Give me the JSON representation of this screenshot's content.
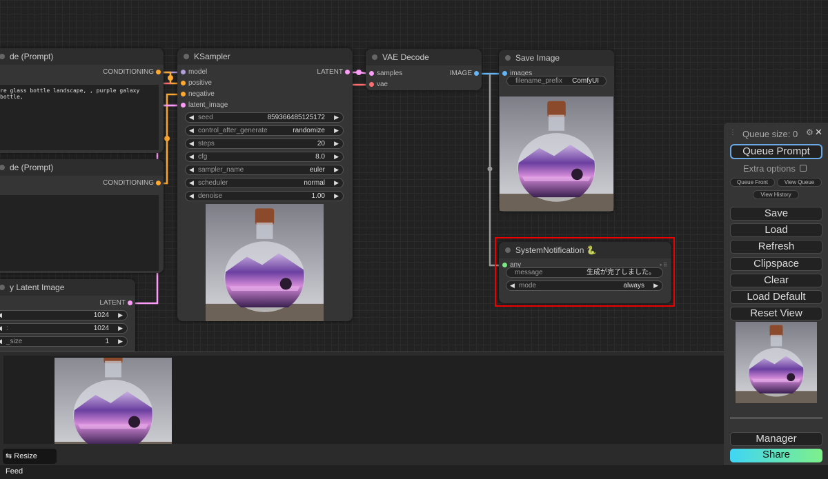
{
  "colors": {
    "conditioning": "#ffa931",
    "latent": "#ff9cf9",
    "model": "#b39ddb",
    "vae": "#ff6e6e",
    "image": "#64b5f6",
    "any": "#7ee787",
    "highlight": "#ee0000",
    "share_gradient": [
      "#3fd5f5",
      "#7ef08a"
    ]
  },
  "nodes": {
    "clip1": {
      "title": "de (Prompt)",
      "outputs": [
        "CONDITIONING"
      ],
      "text": "re glass bottle landscape, , purple galaxy bottle,"
    },
    "clip2": {
      "title": "de (Prompt)",
      "outputs": [
        "CONDITIONING"
      ],
      "text": ""
    },
    "latent": {
      "title": "y Latent Image",
      "outputs": [
        "LATENT"
      ],
      "widgets": [
        {
          "label": "",
          "value": "1024"
        },
        {
          "label": ":",
          "value": "1024"
        },
        {
          "label": "_size",
          "value": "1"
        }
      ]
    },
    "ksampler": {
      "title": "KSampler",
      "inputs": [
        "model",
        "positive",
        "negative",
        "latent_image"
      ],
      "outputs": [
        "LATENT"
      ],
      "widgets": [
        {
          "label": "seed",
          "value": "859366485125172"
        },
        {
          "label": "control_after_generate",
          "value": "randomize"
        },
        {
          "label": "steps",
          "value": "20"
        },
        {
          "label": "cfg",
          "value": "8.0"
        },
        {
          "label": "sampler_name",
          "value": "euler"
        },
        {
          "label": "scheduler",
          "value": "normal"
        },
        {
          "label": "denoise",
          "value": "1.00"
        }
      ]
    },
    "vae": {
      "title": "VAE Decode",
      "inputs": [
        "samples",
        "vae"
      ],
      "outputs": [
        "IMAGE"
      ]
    },
    "save": {
      "title": "Save Image",
      "inputs": [
        "images"
      ],
      "widgets": [
        {
          "label": "filename_prefix",
          "value": "ComfyUI",
          "text": true
        }
      ]
    },
    "notify": {
      "title": "SystemNotification 🐍",
      "inputs": [
        "any"
      ],
      "widgets": [
        {
          "label": "message",
          "value": "生成が完了しました。",
          "text": true
        },
        {
          "label": "mode",
          "value": "always"
        }
      ]
    }
  },
  "menu": {
    "queue_size": "Queue size: 0",
    "queue_prompt": "Queue Prompt",
    "extra_options": "Extra options",
    "queue_front": "Queue Front",
    "view_queue": "View Queue",
    "view_history": "View History",
    "buttons": [
      "Save",
      "Load",
      "Refresh",
      "Clipspace",
      "Clear",
      "Load Default",
      "Reset View"
    ],
    "manager": "Manager",
    "share": "Share"
  },
  "feed": {
    "resize_label": "Resize Feed"
  }
}
